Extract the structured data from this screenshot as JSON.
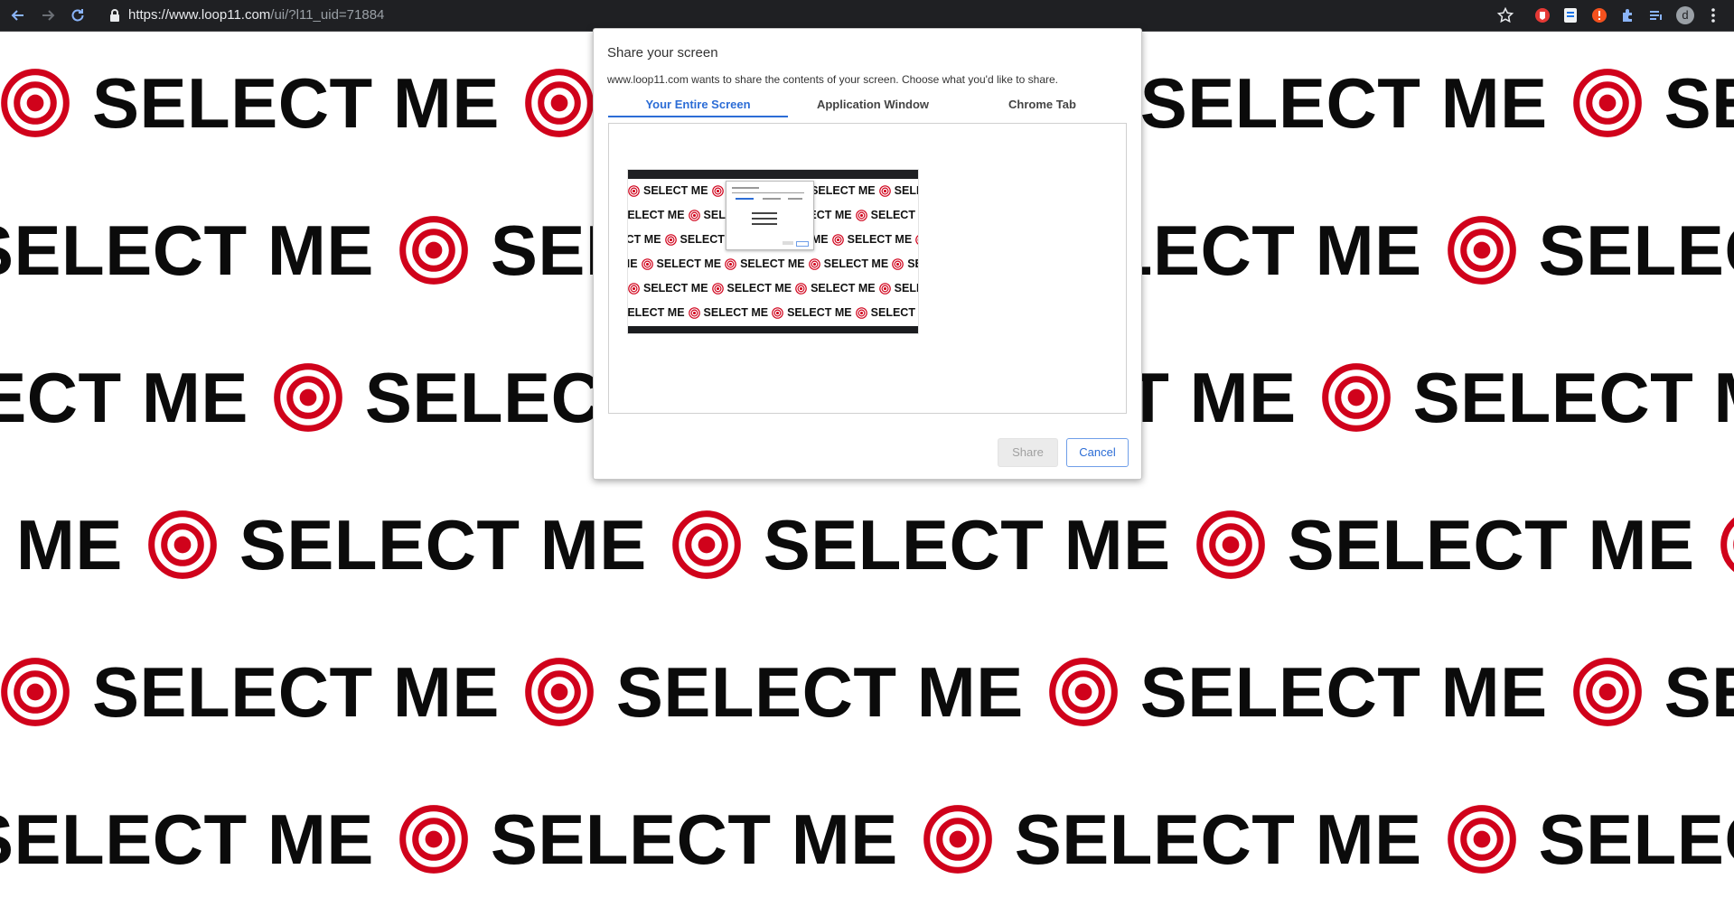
{
  "browser": {
    "url_host": "https://www.loop11.com",
    "url_path": "/ui/?l11_uid=71884",
    "profile_initial": "d"
  },
  "background": {
    "repeated_text": "SELECT ME",
    "text_color": "#0b0b0b",
    "target_color": "#d0021b"
  },
  "dialog": {
    "title": "Share your screen",
    "subtitle": "www.loop11.com wants to share the contents of your screen. Choose what you'd like to share.",
    "tabs": [
      {
        "label": "Your Entire Screen",
        "active": true
      },
      {
        "label": "Application Window",
        "active": false
      },
      {
        "label": "Chrome Tab",
        "active": false
      }
    ],
    "share_label": "Share",
    "cancel_label": "Cancel",
    "accent_color": "#2c6dd6"
  }
}
